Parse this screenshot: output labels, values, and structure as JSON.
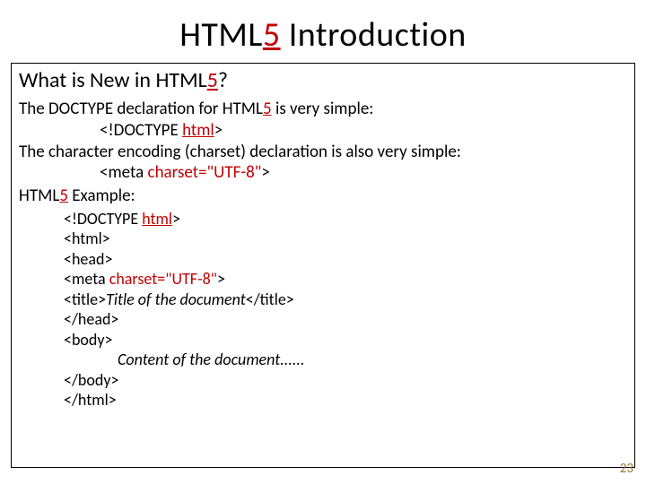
{
  "title": {
    "pre": "HTML",
    "red": "5",
    "post": " Introduction"
  },
  "subheading": {
    "pre": "What is New in HTML",
    "red": "5",
    "post": "?"
  },
  "body": {
    "p1_pre": "The DOCTYPE declaration for HTML",
    "p1_red": "5",
    "p1_post": " is very simple:",
    "code1_pre": "<!DOCTYPE ",
    "code1_red": "html",
    "code1_post": ">",
    "p2": "The character encoding (charset) declaration is also very simple:",
    "code2_pre": "<meta ",
    "code2_red": "charset=\"UTF-8\"",
    "code2_post": ">",
    "ex_pre": "HTML",
    "ex_red": "5",
    "ex_post": " Example:"
  },
  "example": {
    "l1_pre": "<!DOCTYPE ",
    "l1_red": "html",
    "l1_post": ">",
    "l2": "<html>",
    "l3": "<head>",
    "l4_pre": "<meta ",
    "l4_red": "charset=\"UTF-8\"",
    "l4_post": ">",
    "l5_pre": "<title>",
    "l5_mid": "Title of the document",
    "l5_post": "</title>",
    "l6": "</head>",
    "l7": "<body>",
    "l8": "Content of the document......",
    "l9": "</body>",
    "l10": "</html>"
  },
  "page_number": "23"
}
